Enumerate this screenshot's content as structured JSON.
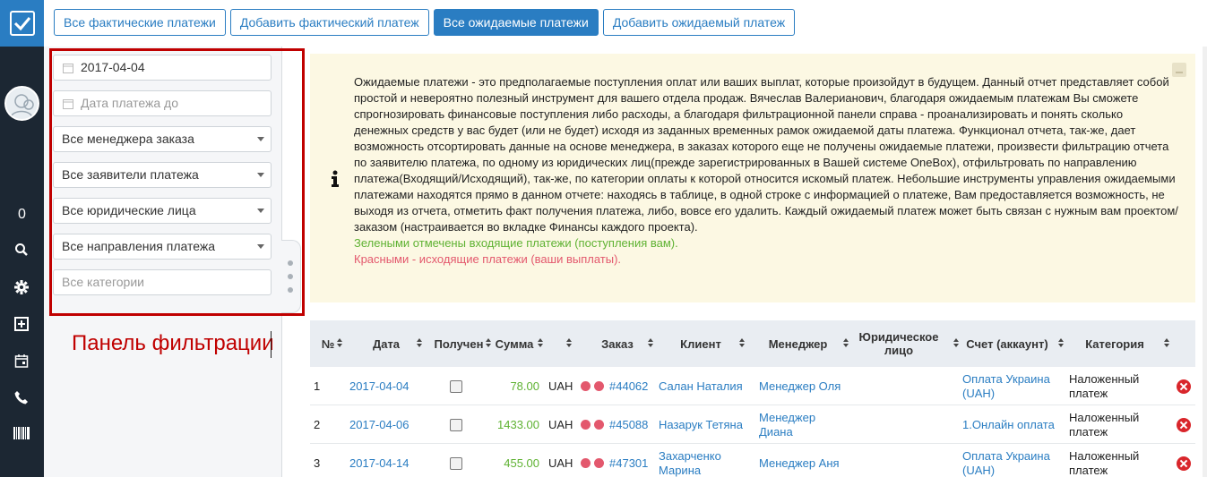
{
  "tabs": [
    {
      "label": "Все фактические платежи",
      "active": false
    },
    {
      "label": "Добавить фактический платеж",
      "active": false
    },
    {
      "label": "Все ожидаемые платежи",
      "active": true
    },
    {
      "label": "Добавить ожидаемый платеж",
      "active": false
    }
  ],
  "sidebar": {
    "counter": "0",
    "icons": [
      "search-icon",
      "gear-icon",
      "add-box-icon",
      "calendar-icon",
      "phone-icon",
      "barcode-icon"
    ]
  },
  "filters": {
    "date_from": "2017-04-04",
    "date_to_placeholder": "Дата платежа до",
    "manager": "Все менеджера заказа",
    "applicant": "Все заявители платежа",
    "legal": "Все юридические лица",
    "direction": "Все направления платежа",
    "category_placeholder": "Все категории"
  },
  "annotation": "Панель фильтрации",
  "info": {
    "main": "Ожидаемые платежи - это предполагаемые поступления оплат или ваших выплат, которые произойдут в будущем. Данный отчет представляет собой простой и невероятно полезный инструмент для вашего отдела продаж. Вячеслав Валерианович, благодаря ожидаемым платежам Вы сможете спрогнозировать финансовые поступления либо расходы, а благодаря фильтрационной панели справа - проанализировать и понять сколько денежных средств у вас будет (или не будет) исходя из заданных временных рамок ожидаемой даты платежа. Функционал отчета, так-же, дает возможность отсортировать данные на основе менеджера, в заказах которого еще не получены ожидаемые платежи, произвести фильтрацию отчета по заявителю платежа, по одному из юридических лиц(прежде зарегистрированных в Вашей системе OneBox), отфильтровать по направлению платежа(Входящий/Исходящий), так-же, по категории оплаты к которой относится искомый платеж. Небольшие инструменты управления ожидаемыми платежами находятся прямо в данном отчете: находясь в таблице, в одной строке с информацией о платеже, Вам предоставляется возможность, не выходя из отчета, отметить факт получения платежа, либо, вовсе его удалить. Каждый ожидаемый платеж может быть связан с нужным вам проектом/заказом (настраивается во вкладке Финансы каждого проекта).",
    "green": "Зелеными отмечены входящие платежи (поступления вам).",
    "red": "Красными - исходящие платежи (ваши выплаты)."
  },
  "table": {
    "headers": {
      "num": "№",
      "date": "Дата",
      "received": "Получен",
      "sum": "Сумма",
      "order": "Заказ",
      "client": "Клиент",
      "manager": "Менеджер",
      "legal": "Юридическое лицо",
      "account": "Счет (аккаунт)",
      "category": "Категория"
    },
    "rows": [
      {
        "num": "1",
        "date": "2017-04-04",
        "sum": "78.00",
        "currency": "UAH",
        "order": "#44062",
        "client": "Салан Наталия",
        "manager": "Менеджер Оля",
        "account": "Оплата Украина (UAH)",
        "category": "Наложенный платеж"
      },
      {
        "num": "2",
        "date": "2017-04-06",
        "sum": "1433.00",
        "currency": "UAH",
        "order": "#45088",
        "client": "Назарук Тетяна",
        "manager": "Менеджер Диана",
        "account": "1.Онлайн оплата",
        "category": "Наложенный платеж"
      },
      {
        "num": "3",
        "date": "2017-04-14",
        "sum": "455.00",
        "currency": "UAH",
        "order": "#47301",
        "client": "Захарченко Марина",
        "manager": "Менеджер Аня",
        "account": "Оплата Украина (UAH)",
        "category": "Наложенный платеж"
      }
    ]
  },
  "colors": {
    "accent": "#2a7dc2",
    "green": "#5fb233",
    "red": "#e3586d",
    "annotation": "#c00000"
  }
}
